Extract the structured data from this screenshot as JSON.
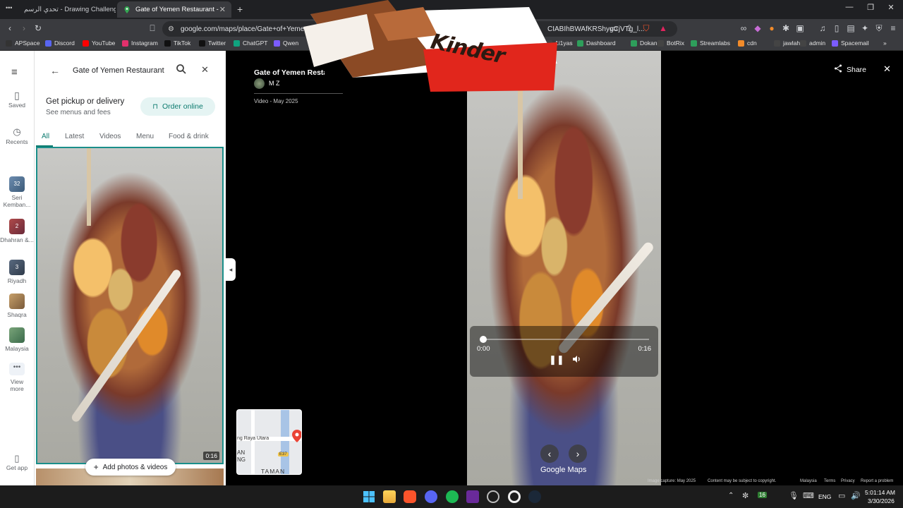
{
  "browser": {
    "tabs": [
      {
        "title": "تحدي الرسم - Drawing Challenge | جو"
      },
      {
        "title": "Gate of Yemen Restaurant - Goo",
        "active": true
      }
    ],
    "url": "google.com/maps/place/Gate+of+Yemen...",
    "url_tail": "CIABIhBWAfKRShygCjVTg_l...",
    "bookmarks": [
      "APSpace",
      "Discord",
      "YouTube",
      "Instagram",
      "TikTok",
      "Twitter",
      "ChatGPT",
      "Qwen",
      "1i1yas",
      "Dashboard",
      "Dokan",
      "BotRix",
      "Streamlabs",
      "cdn",
      "jawlah",
      "admin",
      "Spacemail"
    ]
  },
  "rail": {
    "items": [
      {
        "label": "Saved",
        "icon": "bookmark-icon"
      },
      {
        "label": "Recents",
        "icon": "history-icon"
      }
    ],
    "recents": [
      {
        "label": "Seri Kemban...",
        "badge": "32"
      },
      {
        "label": "Dhahran &...",
        "badge": "2"
      },
      {
        "label": "Riyadh",
        "badge": "3"
      },
      {
        "label": "Shaqra"
      },
      {
        "label": "Malaysia"
      }
    ],
    "view_more": "View more",
    "get_app": "Get app"
  },
  "panel": {
    "search_value": "Gate of Yemen Restaurant",
    "pickup_title": "Get pickup or delivery",
    "pickup_sub": "See menus and fees",
    "order_label": "Order online",
    "tabs": [
      "All",
      "Latest",
      "Videos",
      "Menu",
      "Food & drink"
    ],
    "thumb_duration": "0:16",
    "add_photos": "Add photos & videos"
  },
  "viewer": {
    "title": "Gate of Yemen Restaurant",
    "author": "M Z",
    "meta": "Video - May 2025",
    "share": "Share",
    "time_current": "0:00",
    "time_total": "0:16",
    "progress": 0.02,
    "brand": "Google Maps",
    "sticker_text": "Kinder",
    "map_labels": [
      "ng Raya Utara",
      "AN",
      "NG",
      "TAMAN",
      "E37"
    ],
    "footer": [
      "Image capture: May 2025",
      "Content may be subject to copyright.",
      "Malaysia",
      "Terms",
      "Privacy",
      "Report a problem"
    ]
  },
  "taskbar": {
    "lang": "ENG",
    "time": "5:01:14 AM",
    "date": "3/30/2026",
    "weather_badge": "16"
  }
}
